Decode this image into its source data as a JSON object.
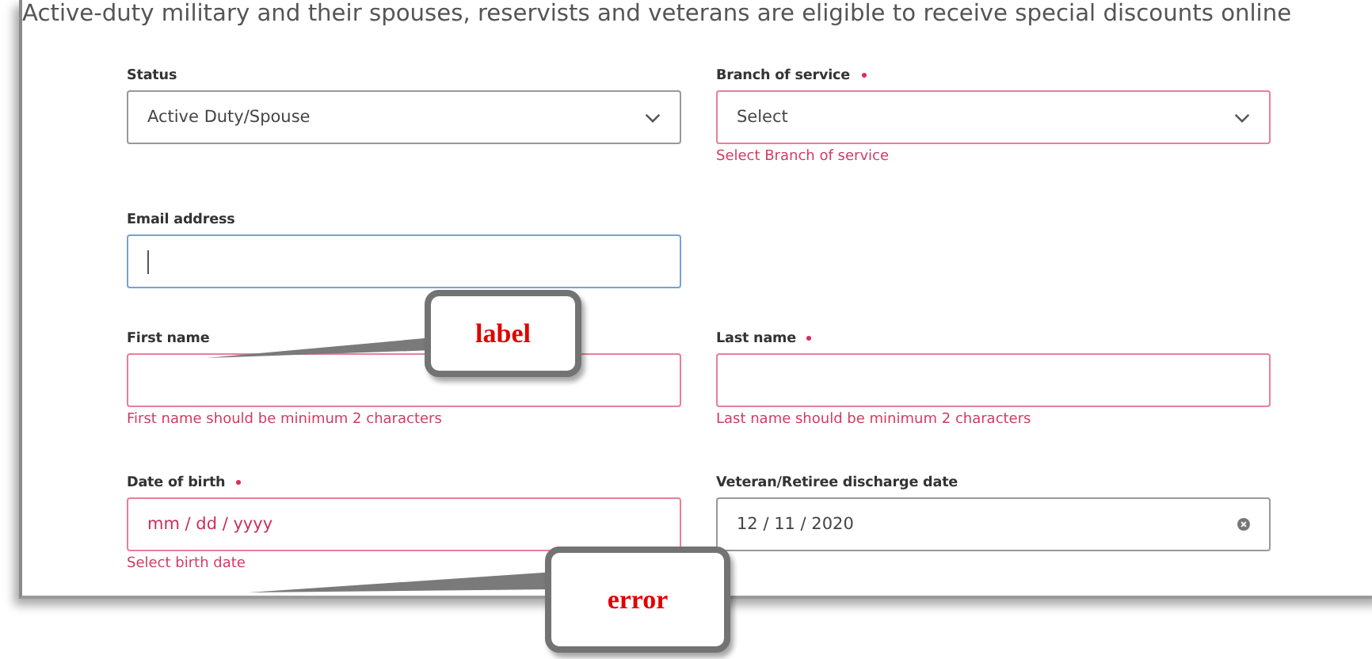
{
  "intro": "Active-duty military and their spouses, reservists and veterans are eligible to receive special discounts online",
  "rows": [
    [
      {
        "kind": "select",
        "label": "Status",
        "required": false,
        "value": "Active Duty/Spouse",
        "focused": false,
        "invalid": false
      },
      {
        "kind": "select",
        "label": "Branch of service",
        "required": true,
        "value": "Select",
        "focused": false,
        "invalid": true,
        "error": "Select Branch of service"
      }
    ],
    [
      {
        "kind": "text",
        "label": "Email address",
        "required": false,
        "focused": true,
        "invalid": false
      }
    ],
    [
      {
        "kind": "text",
        "label": "First name",
        "required": false,
        "focused": false,
        "invalid": true,
        "error": "First name should be minimum 2 characters"
      },
      {
        "kind": "text",
        "label": "Last name",
        "required": true,
        "focused": false,
        "invalid": true,
        "error": "Last name should be minimum 2 characters"
      }
    ],
    [
      {
        "kind": "date",
        "label": "Date of birth",
        "required": true,
        "placeholder": "mm / dd / yyyy",
        "focused": false,
        "invalid": true,
        "error": "Select birth date"
      },
      {
        "kind": "date",
        "label": "Veteran/Retiree discharge date",
        "required": false,
        "value": "12 / 11 / 2020",
        "focused": false,
        "invalid": false
      }
    ]
  ],
  "callouts": [
    {
      "text": "label"
    },
    {
      "text": "error"
    }
  ]
}
